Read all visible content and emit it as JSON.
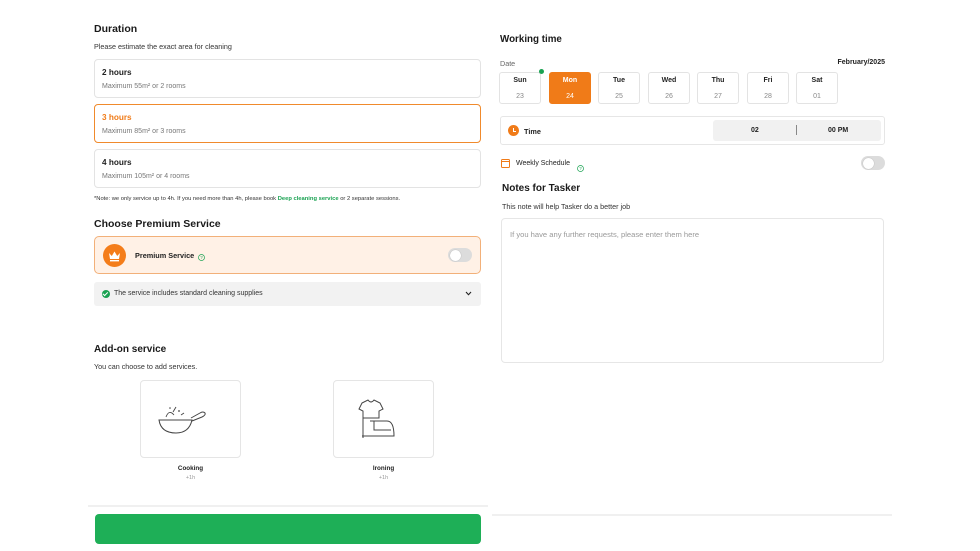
{
  "duration": {
    "title": "Duration",
    "subtitle": "Please estimate the exact area for cleaning",
    "options": [
      {
        "title": "2 hours",
        "desc": "Maximum 55m² or 2 rooms",
        "selected": false
      },
      {
        "title": "3 hours",
        "desc": "Maximum 85m² or 3 rooms",
        "selected": true
      },
      {
        "title": "4 hours",
        "desc": "Maximum 105m² or 4 rooms",
        "selected": false
      }
    ],
    "note_prefix": "*Note: we only service up to 4h. If you need more than 4h, please book ",
    "note_link": "Deep cleaning service",
    "note_suffix": " or 2 separate sessions."
  },
  "premium": {
    "title": "Choose Premium Service",
    "label": "Premium Service",
    "enabled": false,
    "supplies_text": "The service includes standard cleaning supplies"
  },
  "addon": {
    "title": "Add-on service",
    "subtitle": "You can choose to add services.",
    "items": [
      {
        "name": "Cooking",
        "sub": "+1h",
        "icon": "cooking-pan-icon"
      },
      {
        "name": "Ironing",
        "sub": "+1h",
        "icon": "ironing-icon"
      }
    ]
  },
  "working_time": {
    "title": "Working time",
    "date_label": "Date",
    "month": "February/2025",
    "days": [
      {
        "name": "Sun",
        "date": "23",
        "selected": false
      },
      {
        "name": "Mon",
        "date": "24",
        "selected": true
      },
      {
        "name": "Tue",
        "date": "25",
        "selected": false
      },
      {
        "name": "Wed",
        "date": "26",
        "selected": false
      },
      {
        "name": "Thu",
        "date": "27",
        "selected": false
      },
      {
        "name": "Fri",
        "date": "28",
        "selected": false
      },
      {
        "name": "Sat",
        "date": "01",
        "selected": false
      }
    ],
    "time_label": "Time",
    "hour": "02",
    "period": "00 PM",
    "weekly_label": "Weekly Schedule",
    "weekly_enabled": false
  },
  "notes": {
    "title": "Notes for Tasker",
    "subtitle": "This note will help Tasker do a better job",
    "placeholder": "If you have any further requests, please enter them here"
  },
  "colors": {
    "accent": "#f07b18",
    "green": "#1eaf57"
  }
}
